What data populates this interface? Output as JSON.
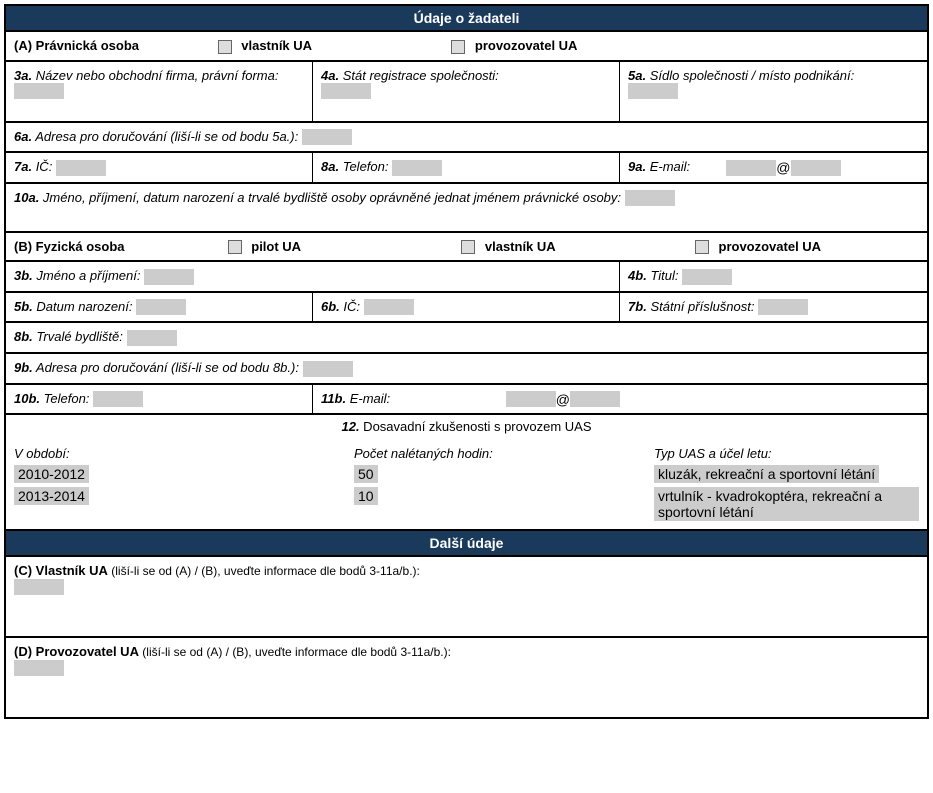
{
  "headers": {
    "applicant": "Údaje o žadateli",
    "other": "Další údaje"
  },
  "sectionA": {
    "title": "(A) Právnická osoba",
    "cb1": "vlastník UA",
    "cb2": "provozovatel UA",
    "f3a_num": "3a.",
    "f3a_text": " Název nebo obchodní firma, právní forma:",
    "f4a_num": "4a.",
    "f4a_text": " Stát registrace společnosti:",
    "f5a_num": "5a.",
    "f5a_text": " Sídlo společnosti / místo podnikání:",
    "f6a_num": "6a.",
    "f6a_text": " Adresa pro doručování (liší-li se od bodu 5a.):",
    "f7a_num": "7a.",
    "f7a_text": " IČ:",
    "f8a_num": "8a.",
    "f8a_text": " Telefon:",
    "f9a_num": "9a.",
    "f9a_text": " E-mail:",
    "f10a_num": "10a.",
    "f10a_text": " Jméno, příjmení, datum narození a trvalé bydliště osoby oprávněné jednat jménem právnické osoby:"
  },
  "sectionB": {
    "title": "(B) Fyzická osoba",
    "cb1": "pilot UA",
    "cb2": "vlastník UA",
    "cb3": "provozovatel UA",
    "f3b_num": "3b.",
    "f3b_text": " Jméno a příjmení:",
    "f4b_num": "4b.",
    "f4b_text": " Titul:",
    "f5b_num": "5b.",
    "f5b_text": " Datum narození:",
    "f6b_num": "6b.",
    "f6b_text": " IČ:",
    "f7b_num": "7b.",
    "f7b_text": " Státní příslušnost:",
    "f8b_num": "8b.",
    "f8b_text": " Trvalé bydliště:",
    "f9b_num": "9b.",
    "f9b_text": " Adresa pro doručování (liší-li se od bodu 8b.):",
    "f10b_num": "10b.",
    "f10b_text": " Telefon:",
    "f11b_num": "11b.",
    "f11b_text": " E-mail:"
  },
  "experience": {
    "header_num": "12.",
    "header_text": " Dosavadní zkušenosti s provozem UAS",
    "col1": "V období:",
    "col2": "Počet nalétaných hodin:",
    "col3": "Typ UAS a účel letu:",
    "rows": [
      {
        "period": "2010-2012",
        "hours": "50",
        "type": "kluzák, rekreační a sportovní létání"
      },
      {
        "period": "2013-2014",
        "hours": "10",
        "type": "vrtulník - kvadrokoptéra, rekreační a sportovní létání"
      }
    ]
  },
  "sectionC": {
    "title": "(C) Vlastník UA",
    "note": " (liší-li se od (A) / (B), uveďte informace dle bodů 3-11a/b.):"
  },
  "sectionD": {
    "title": "(D) Provozovatel UA",
    "note": " (liší-li se od (A) / (B), uveďte informace dle bodů 3-11a/b.):"
  },
  "at": "@"
}
